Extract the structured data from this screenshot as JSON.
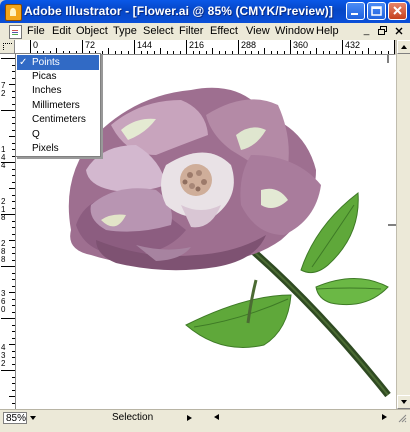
{
  "window": {
    "title": "Adobe Illustrator - [Flower.ai @ 85% (CMYK/Preview)]"
  },
  "menubar": {
    "items": [
      "File",
      "Edit",
      "Object",
      "Type",
      "Select",
      "Filter",
      "Effect",
      "View",
      "Window",
      "Help"
    ]
  },
  "ruler": {
    "h_labels": [
      "0",
      "72",
      "144",
      "216",
      "288",
      "360",
      "432"
    ],
    "v_labels": [
      "7",
      "2",
      "1",
      "4",
      "4",
      "2",
      "1",
      "8",
      "2",
      "8",
      "8",
      "3",
      "6",
      "0",
      "4",
      "3",
      "2"
    ]
  },
  "units_menu": {
    "items": [
      {
        "label": "Points",
        "checked": true,
        "selected": true
      },
      {
        "label": "Picas",
        "checked": false,
        "selected": false
      },
      {
        "label": "Inches",
        "checked": false,
        "selected": false
      },
      {
        "label": "Millimeters",
        "checked": false,
        "selected": false
      },
      {
        "label": "Centimeters",
        "checked": false,
        "selected": false
      },
      {
        "label": "Q",
        "checked": false,
        "selected": false
      },
      {
        "label": "Pixels",
        "checked": false,
        "selected": false
      }
    ],
    "check_glyph": "✓"
  },
  "statusbar": {
    "zoom": "85%",
    "status": "Selection"
  },
  "icons": {
    "app": "illustrator-flower-icon",
    "document": "document-icon"
  },
  "colors": {
    "title_bar": "#0546c6",
    "menu_highlight": "#316ac5",
    "petal": "#b48aa6",
    "leaf": "#5fa83a",
    "stem": "#2f4a22"
  }
}
